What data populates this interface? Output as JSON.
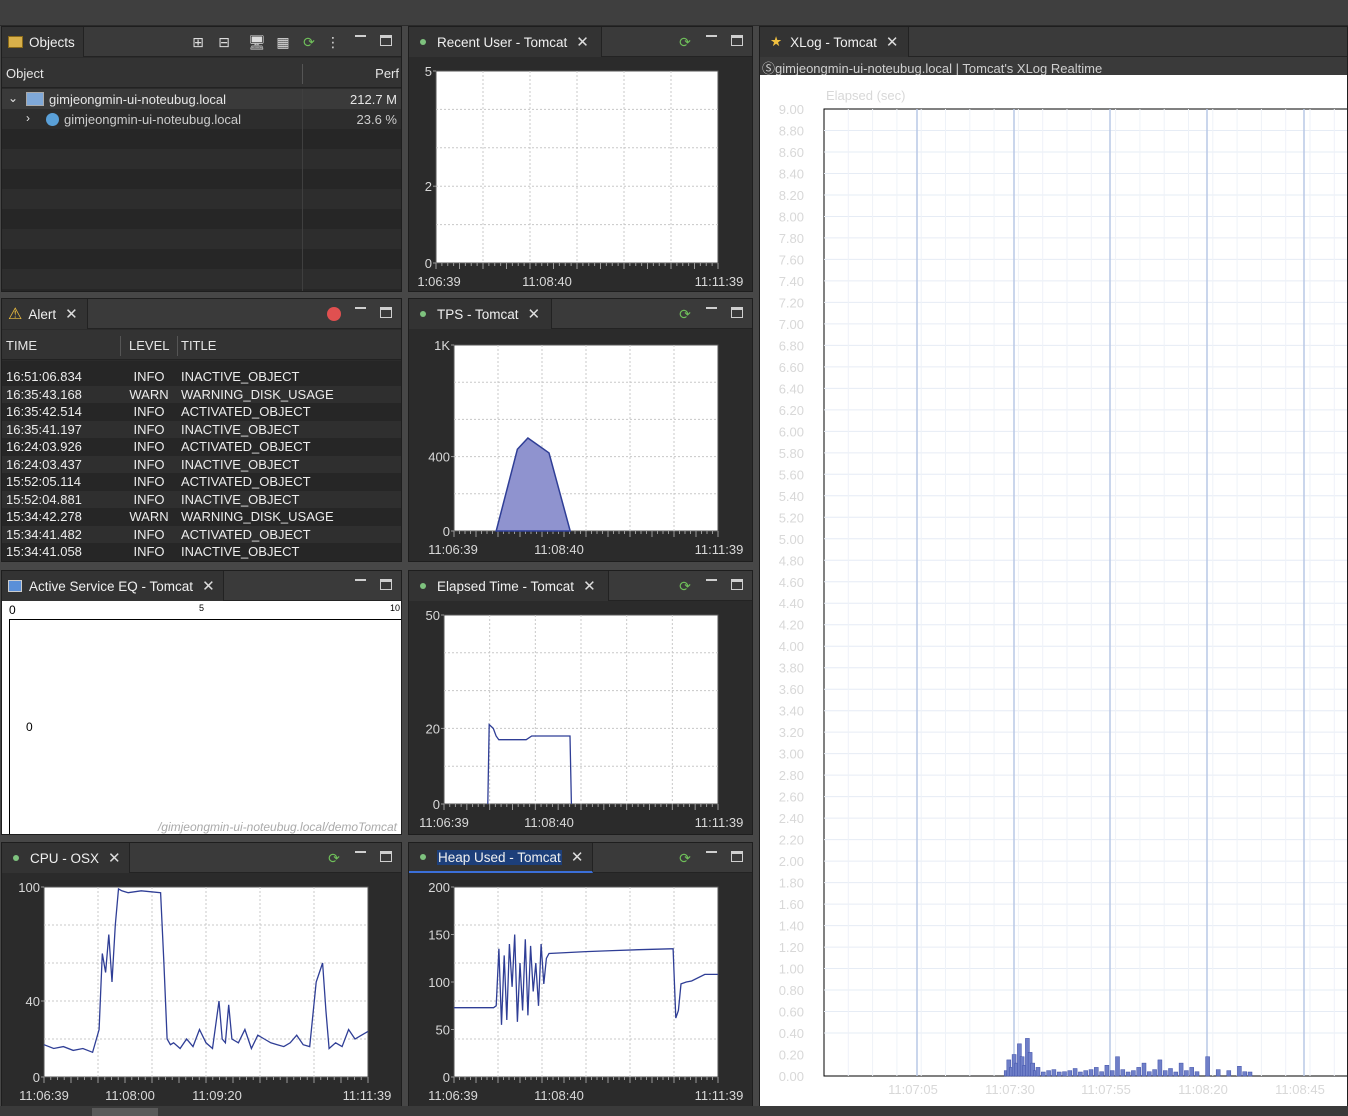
{
  "objects": {
    "tab_label": "Objects",
    "col_object": "Object",
    "col_perf": "Perf",
    "rows": [
      {
        "name": "gimjeongmin-ui-noteubug.local",
        "perf": "212.7 M"
      },
      {
        "name": "gimjeongmin-ui-noteubug.local",
        "perf": "23.6 %"
      }
    ]
  },
  "alert": {
    "tab_label": "Alert",
    "col_time": "TIME",
    "col_level": "LEVEL",
    "col_title": "TITLE",
    "rows": [
      {
        "time": "16:51:06.834",
        "level": "INFO",
        "title": "INACTIVE_OBJECT"
      },
      {
        "time": "16:35:43.168",
        "level": "WARN",
        "title": "WARNING_DISK_USAGE"
      },
      {
        "time": "16:35:42.514",
        "level": "INFO",
        "title": "ACTIVATED_OBJECT"
      },
      {
        "time": "16:35:41.197",
        "level": "INFO",
        "title": "INACTIVE_OBJECT"
      },
      {
        "time": "16:24:03.926",
        "level": "INFO",
        "title": "ACTIVATED_OBJECT"
      },
      {
        "time": "16:24:03.437",
        "level": "INFO",
        "title": "INACTIVE_OBJECT"
      },
      {
        "time": "15:52:05.114",
        "level": "INFO",
        "title": "ACTIVATED_OBJECT"
      },
      {
        "time": "15:52:04.881",
        "level": "INFO",
        "title": "INACTIVE_OBJECT"
      },
      {
        "time": "15:34:42.278",
        "level": "WARN",
        "title": "WARNING_DISK_USAGE"
      },
      {
        "time": "15:34:41.482",
        "level": "INFO",
        "title": "ACTIVATED_OBJECT"
      },
      {
        "time": "15:34:41.058",
        "level": "INFO",
        "title": "INACTIVE_OBJECT"
      }
    ]
  },
  "active_service": {
    "tab_label": "Active Service EQ - Tomcat",
    "scale": [
      "0",
      "5",
      "10"
    ],
    "value": "0",
    "path": "/gimjeongmin-ui-noteubug.local/demoTomcat"
  },
  "cpu": {
    "tab_label": "CPU - OSX"
  },
  "recent_user": {
    "tab_label": "Recent User - Tomcat"
  },
  "tps": {
    "tab_label": "TPS - Tomcat"
  },
  "elapsed": {
    "tab_label": "Elapsed Time - Tomcat"
  },
  "heap": {
    "tab_label": "Heap Used - Tomcat"
  },
  "xlog": {
    "tab_label": "XLog - Tomcat",
    "subtitle": "Ⓢgimjeongmin-ui-noteubug.local | Tomcat's XLog Realtime",
    "ylabel": "Elapsed (sec)"
  },
  "colors": {
    "series": "#2f3e96",
    "fill": "#8f93cf",
    "grid": "#c8c8c8"
  },
  "chart_data": [
    {
      "id": "recent_user",
      "type": "line",
      "title": "",
      "yticks": [
        "0",
        "2",
        "5"
      ],
      "ylim": [
        0,
        5
      ],
      "xticks": [
        "1:06:39",
        "11:08:40",
        "11:11:39"
      ],
      "series": [
        {
          "values": []
        }
      ]
    },
    {
      "id": "tps",
      "type": "area",
      "title": "",
      "yticks": [
        "0",
        "400",
        "1K"
      ],
      "ylim": [
        0,
        1000
      ],
      "xticks": [
        "11:06:39",
        "11:08:40",
        "11:11:39"
      ],
      "series": [
        {
          "x": [
            0.16,
            0.24,
            0.28,
            0.3,
            0.36,
            0.44
          ],
          "values": [
            0,
            440,
            500,
            480,
            420,
            0
          ]
        }
      ]
    },
    {
      "id": "elapsed",
      "type": "line",
      "title": "",
      "yticks": [
        "0",
        "20",
        "50"
      ],
      "ylim": [
        0,
        50
      ],
      "xticks": [
        "11:06:39",
        "11:08:40",
        "11:11:39"
      ],
      "series": [
        {
          "x": [
            0.16,
            0.165,
            0.18,
            0.19,
            0.2,
            0.22,
            0.3,
            0.32,
            0.46,
            0.465
          ],
          "values": [
            0,
            21,
            20,
            18,
            17,
            17,
            17,
            18,
            18,
            0
          ]
        }
      ]
    },
    {
      "id": "cpu",
      "type": "line",
      "title": "",
      "yticks": [
        "0",
        "40",
        "100"
      ],
      "ylim": [
        0,
        100
      ],
      "xticks": [
        "11:06:39",
        "11:08:00",
        "11:09:20",
        "11:11:39"
      ],
      "series": [
        {
          "x": [
            0,
            0.03,
            0.06,
            0.09,
            0.12,
            0.15,
            0.17,
            0.18,
            0.19,
            0.2,
            0.21,
            0.22,
            0.23,
            0.24,
            0.26,
            0.3,
            0.36,
            0.37,
            0.38,
            0.39,
            0.4,
            0.42,
            0.44,
            0.46,
            0.48,
            0.5,
            0.52,
            0.54,
            0.55,
            0.56,
            0.57,
            0.58,
            0.6,
            0.62,
            0.64,
            0.66,
            0.68,
            0.7,
            0.72,
            0.74,
            0.76,
            0.78,
            0.8,
            0.82,
            0.84,
            0.85,
            0.86,
            0.87,
            0.88,
            0.9,
            0.92,
            0.94,
            0.96,
            0.98,
            1.0
          ],
          "values": [
            17,
            15,
            16,
            14,
            15,
            13,
            25,
            65,
            55,
            75,
            50,
            80,
            99,
            98,
            97,
            98,
            97,
            60,
            20,
            17,
            18,
            15,
            20,
            16,
            25,
            18,
            15,
            40,
            20,
            18,
            38,
            20,
            18,
            25,
            15,
            22,
            20,
            18,
            17,
            16,
            18,
            22,
            17,
            16,
            50,
            55,
            60,
            35,
            15,
            18,
            16,
            25,
            20,
            22,
            24
          ]
        }
      ]
    },
    {
      "id": "heap",
      "type": "line",
      "title": "",
      "yticks": [
        "0",
        "50",
        "100",
        "150",
        "200"
      ],
      "ylim": [
        0,
        200
      ],
      "xticks": [
        "11:06:39",
        "11:08:40",
        "11:11:39"
      ],
      "series": [
        {
          "x": [
            0,
            0.15,
            0.16,
            0.17,
            0.18,
            0.19,
            0.2,
            0.21,
            0.22,
            0.23,
            0.24,
            0.25,
            0.26,
            0.27,
            0.28,
            0.29,
            0.3,
            0.31,
            0.32,
            0.33,
            0.34,
            0.35,
            0.36,
            0.5,
            0.6,
            0.7,
            0.82,
            0.83,
            0.84,
            0.85,
            0.86,
            0.88,
            0.9,
            0.95,
            1.0
          ],
          "values": [
            73,
            73,
            75,
            135,
            55,
            128,
            60,
            140,
            95,
            150,
            58,
            120,
            70,
            145,
            65,
            138,
            90,
            120,
            75,
            140,
            98,
            125,
            130,
            132,
            133,
            134,
            135,
            135,
            62,
            70,
            98,
            100,
            101,
            108,
            108
          ]
        }
      ]
    },
    {
      "id": "xlog",
      "type": "scatter",
      "title": "",
      "ylabel": "Elapsed (sec)",
      "ylim": [
        0,
        9
      ],
      "yticks": [
        "9.00",
        "8.80",
        "8.60",
        "8.40",
        "8.20",
        "8.00",
        "7.80",
        "7.60",
        "7.40",
        "7.20",
        "7.00",
        "6.80",
        "6.60",
        "6.40",
        "6.20",
        "6.00",
        "5.80",
        "5.60",
        "5.40",
        "5.20",
        "5.00",
        "4.80",
        "4.60",
        "4.40",
        "4.20",
        "4.00",
        "3.80",
        "3.60",
        "3.40",
        "3.20",
        "3.00",
        "2.80",
        "2.60",
        "2.40",
        "2.20",
        "2.00",
        "1.80",
        "1.60",
        "1.40",
        "1.20",
        "1.00",
        "0.80",
        "0.60",
        "0.40",
        "0.20",
        "0.00"
      ],
      "xticks": [
        "11:07:05",
        "11:07:30",
        "11:07:55",
        "11:08:20",
        "11:08:45"
      ],
      "points_x": [
        0.34,
        0.345,
        0.35,
        0.355,
        0.36,
        0.365,
        0.37,
        0.375,
        0.38,
        0.385,
        0.39,
        0.395,
        0.4,
        0.41,
        0.42,
        0.43,
        0.44,
        0.45,
        0.46,
        0.47,
        0.48,
        0.49,
        0.5,
        0.51,
        0.52,
        0.53,
        0.54,
        0.55,
        0.56,
        0.57,
        0.58,
        0.59,
        0.6,
        0.61,
        0.62,
        0.63,
        0.64,
        0.65,
        0.66,
        0.67,
        0.68,
        0.69,
        0.7,
        0.72,
        0.74,
        0.76,
        0.78,
        0.79,
        0.8
      ],
      "points_y": [
        0.05,
        0.15,
        0.08,
        0.2,
        0.12,
        0.3,
        0.18,
        0.1,
        0.35,
        0.22,
        0.12,
        0.05,
        0.08,
        0.03,
        0.05,
        0.06,
        0.02,
        0.04,
        0.05,
        0.07,
        0.03,
        0.05,
        0.06,
        0.08,
        0.04,
        0.1,
        0.05,
        0.18,
        0.06,
        0.03,
        0.05,
        0.08,
        0.12,
        0.04,
        0.06,
        0.15,
        0.05,
        0.07,
        0.03,
        0.12,
        0.05,
        0.08,
        0.04,
        0.18,
        0.06,
        0.05,
        0.09,
        0.04,
        0.03
      ]
    }
  ]
}
